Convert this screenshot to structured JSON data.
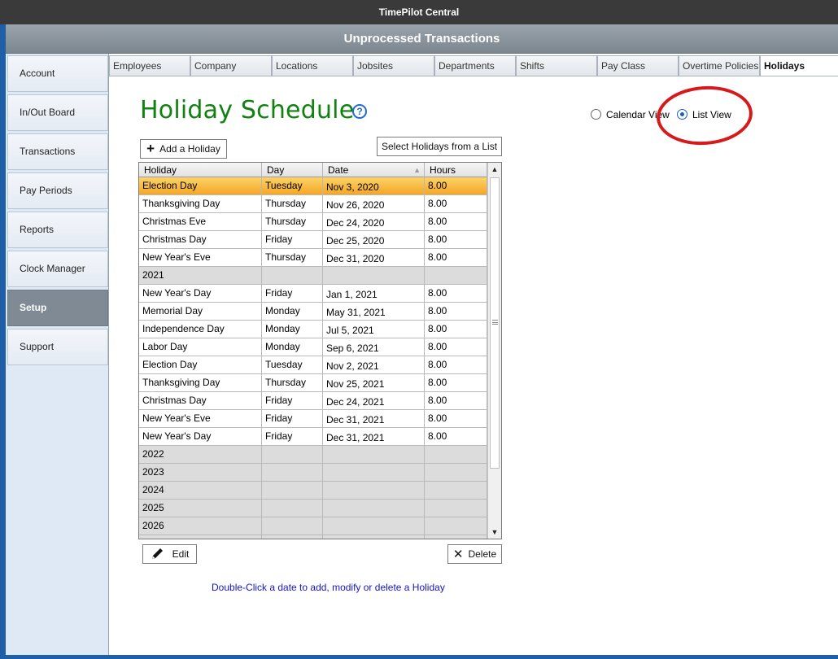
{
  "window": {
    "title": "TimePilot Central"
  },
  "header": {
    "title": "Unprocessed Transactions"
  },
  "sidebar": {
    "items": [
      {
        "label": "Account"
      },
      {
        "label": "In/Out Board"
      },
      {
        "label": "Transactions"
      },
      {
        "label": "Pay Periods"
      },
      {
        "label": "Reports"
      },
      {
        "label": "Clock Manager"
      },
      {
        "label": "Setup",
        "active": true
      },
      {
        "label": "Support"
      }
    ]
  },
  "tabs": [
    {
      "label": "Employees"
    },
    {
      "label": "Company"
    },
    {
      "label": "Locations"
    },
    {
      "label": "Jobsites"
    },
    {
      "label": "Departments"
    },
    {
      "label": "Shifts"
    },
    {
      "label": "Pay Class"
    },
    {
      "label": "Overtime Policies"
    },
    {
      "label": "Holidays",
      "active": true
    }
  ],
  "page": {
    "title": "Holiday Schedule",
    "help_icon": "question-circle-icon",
    "view_options": [
      {
        "label": "Calendar View",
        "checked": false
      },
      {
        "label": "List View",
        "checked": true
      }
    ],
    "add_button": "Add a Holiday",
    "select_button": "Select Holidays from a List",
    "edit_button": "Edit",
    "delete_button": "Delete",
    "hint": "Double-Click a date to add, modify or delete a Holiday",
    "highlight_color": "#d8191c",
    "title_color": "#118211"
  },
  "grid": {
    "columns": [
      "Holiday",
      "Day",
      "Date",
      "Hours"
    ],
    "rows": [
      {
        "holiday": "Election Day",
        "day": "Tuesday",
        "date": "Nov 3, 2020",
        "hours": "8.00",
        "selected": true
      },
      {
        "holiday": "Thanksgiving Day",
        "day": "Thursday",
        "date": "Nov 26, 2020",
        "hours": "8.00"
      },
      {
        "holiday": "Christmas Eve",
        "day": "Thursday",
        "date": "Dec 24, 2020",
        "hours": "8.00"
      },
      {
        "holiday": "Christmas Day",
        "day": "Friday",
        "date": "Dec 25, 2020",
        "hours": "8.00"
      },
      {
        "holiday": "New Year's Eve",
        "day": "Thursday",
        "date": "Dec 31, 2020",
        "hours": "8.00"
      },
      {
        "holiday": "2021",
        "day": "",
        "date": "",
        "hours": "",
        "year": true
      },
      {
        "holiday": "New Year's Day",
        "day": "Friday",
        "date": "Jan 1, 2021",
        "hours": "8.00"
      },
      {
        "holiday": "Memorial Day",
        "day": "Monday",
        "date": "May 31, 2021",
        "hours": "8.00"
      },
      {
        "holiday": "Independence Day",
        "day": "Monday",
        "date": "Jul 5, 2021",
        "hours": "8.00"
      },
      {
        "holiday": "Labor Day",
        "day": "Monday",
        "date": "Sep 6, 2021",
        "hours": "8.00"
      },
      {
        "holiday": "Election Day",
        "day": "Tuesday",
        "date": "Nov 2, 2021",
        "hours": "8.00"
      },
      {
        "holiday": "Thanksgiving Day",
        "day": "Thursday",
        "date": "Nov 25, 2021",
        "hours": "8.00"
      },
      {
        "holiday": "Christmas Day",
        "day": "Friday",
        "date": "Dec 24, 2021",
        "hours": "8.00"
      },
      {
        "holiday": "New Year's Eve",
        "day": "Friday",
        "date": "Dec 31, 2021",
        "hours": "8.00"
      },
      {
        "holiday": "New Year's Day",
        "day": "Friday",
        "date": "Dec 31, 2021",
        "hours": "8.00"
      },
      {
        "holiday": "2022",
        "day": "",
        "date": "",
        "hours": "",
        "year": true
      },
      {
        "holiday": "2023",
        "day": "",
        "date": "",
        "hours": "",
        "year": true
      },
      {
        "holiday": "2024",
        "day": "",
        "date": "",
        "hours": "",
        "year": true
      },
      {
        "holiday": "2025",
        "day": "",
        "date": "",
        "hours": "",
        "year": true
      },
      {
        "holiday": "2026",
        "day": "",
        "date": "",
        "hours": "",
        "year": true
      },
      {
        "holiday": "",
        "day": "",
        "date": "",
        "hours": "",
        "year": true
      }
    ]
  }
}
